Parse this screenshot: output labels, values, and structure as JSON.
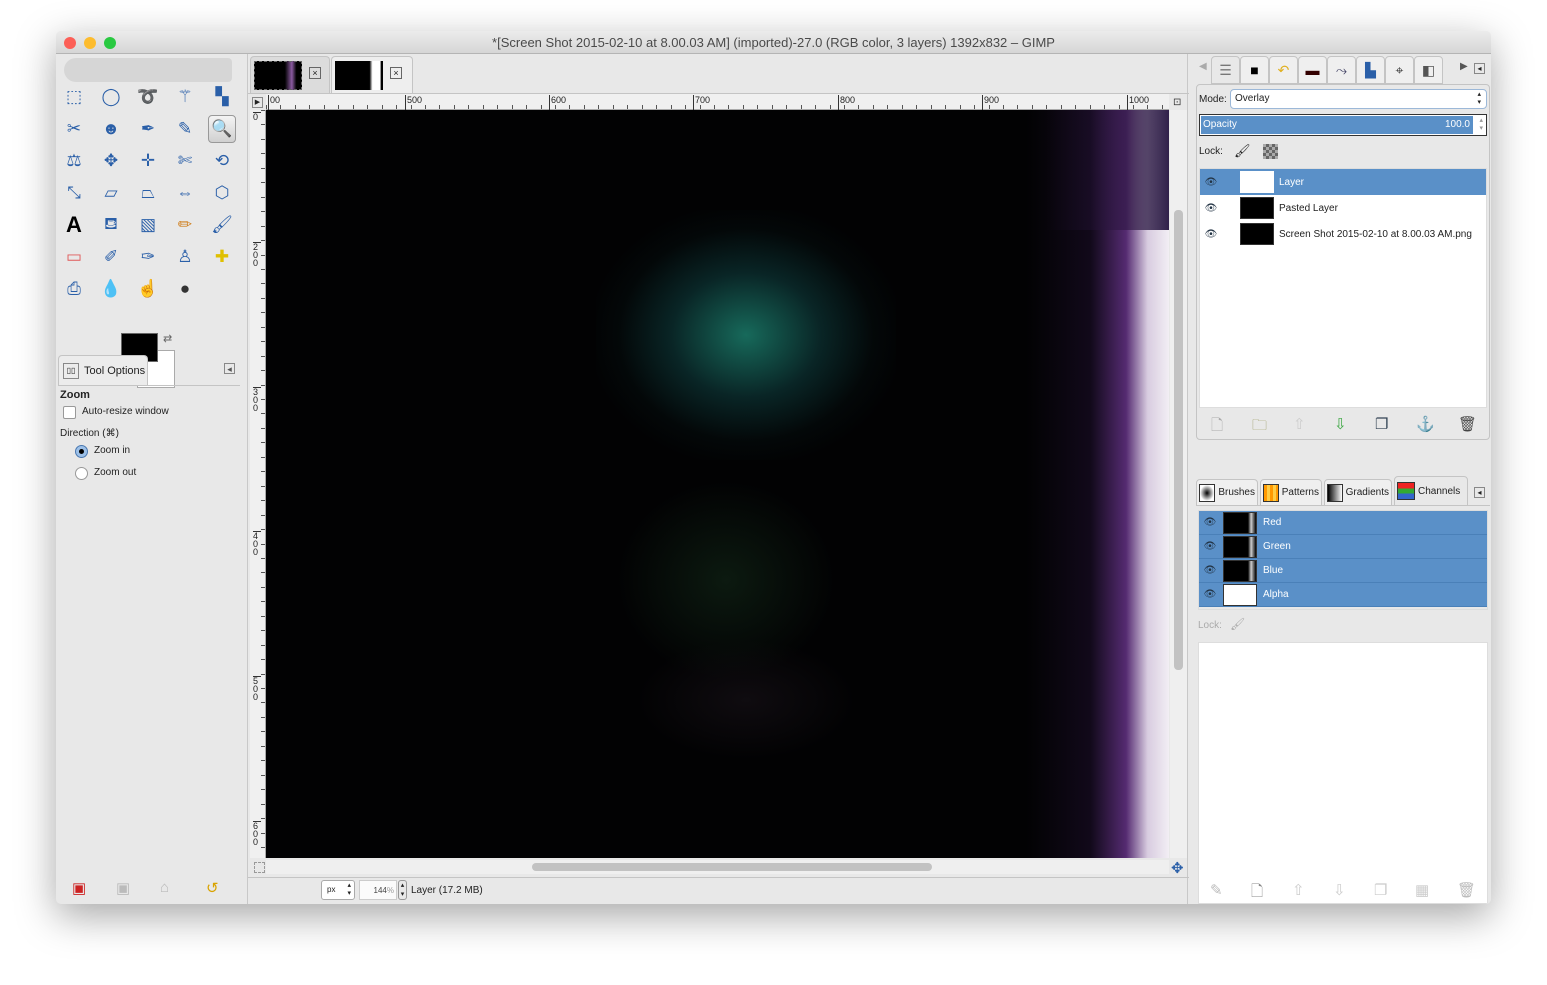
{
  "window": {
    "title": "*[Screen Shot 2015-02-10 at 8.00.03 AM] (imported)-27.0 (RGB color, 3 layers) 1392x832 – GIMP"
  },
  "toolbox": {
    "tools": [
      "rect-select",
      "ellipse-select",
      "free-select",
      "fuzzy-select",
      "select-by-color",
      "scissors",
      "foreground-select",
      "paths",
      "color-picker",
      "zoom",
      "measure",
      "move",
      "align",
      "crop",
      "rotate",
      "scale",
      "shear",
      "perspective",
      "flip",
      "cage-transform",
      "text",
      "bucket-fill",
      "blend",
      "pencil",
      "paintbrush",
      "eraser",
      "airbrush",
      "ink",
      "clone",
      "heal",
      "perspective-clone",
      "blur",
      "smudge",
      "dodge-burn"
    ],
    "selected_tool": "zoom",
    "fg_color": "#000000",
    "bg_color": "#ffffff"
  },
  "tool_options": {
    "tab_label": "Tool Options",
    "section": "Zoom",
    "auto_resize_label": "Auto-resize window",
    "auto_resize_checked": false,
    "direction_label": "Direction  (⌘)",
    "zoom_in": "Zoom in",
    "zoom_out": "Zoom out",
    "selected_direction": "Zoom in"
  },
  "rulers": {
    "top": [
      "00",
      "500",
      "600",
      "700",
      "800",
      "900",
      "1000"
    ],
    "left": [
      "0",
      "200",
      "300",
      "400",
      "500",
      "600"
    ]
  },
  "status": {
    "unit": "px",
    "zoom": "144",
    "zoom_suffix": "%",
    "layer_info": "Layer (17.2 MB)"
  },
  "layers": {
    "mode_label": "Mode:",
    "mode": "Overlay",
    "opacity_label": "Opacity",
    "opacity": "100.0",
    "lock_label": "Lock:",
    "items": [
      {
        "name": "Layer",
        "selected": true
      },
      {
        "name": "Pasted Layer",
        "selected": false
      },
      {
        "name": "Screen Shot 2015-02-10 at 8.00.03 AM.png",
        "selected": false
      }
    ]
  },
  "lower_tabs": [
    "Brushes",
    "Patterns",
    "Gradients",
    "Channels"
  ],
  "active_lower_tab": "Channels",
  "channels": {
    "items": [
      "Red",
      "Green",
      "Blue",
      "Alpha"
    ],
    "lock_label": "Lock:"
  },
  "colors": {
    "selection": "#5a90c8",
    "accent_green": "#3aa640"
  }
}
